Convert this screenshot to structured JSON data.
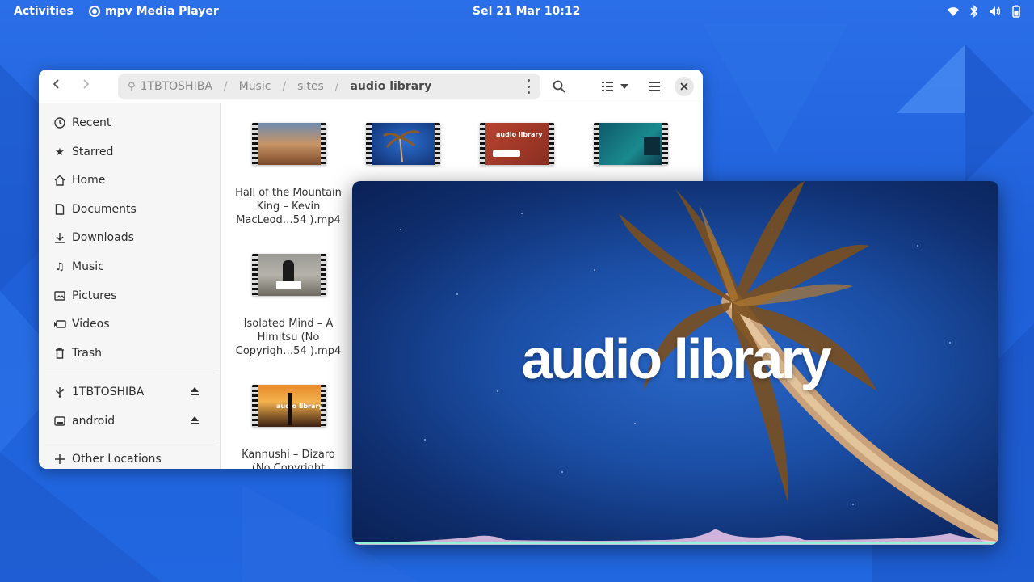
{
  "topbar": {
    "activities": "Activities",
    "app_name": "mpv Media Player",
    "clock": "Sel 21 Mar  10:12",
    "tray_icons": [
      "wifi-icon",
      "bluetooth-icon",
      "volume-icon",
      "battery-icon"
    ]
  },
  "files": {
    "path": {
      "device": "1TBTOSHIBA",
      "segments": [
        "Music",
        "sites"
      ],
      "current": "audio library"
    },
    "sidebar": {
      "places": [
        {
          "label": "Recent",
          "icon": "clock-icon"
        },
        {
          "label": "Starred",
          "icon": "star-icon"
        },
        {
          "label": "Home",
          "icon": "home-icon"
        },
        {
          "label": "Documents",
          "icon": "document-icon"
        },
        {
          "label": "Downloads",
          "icon": "download-icon"
        },
        {
          "label": "Music",
          "icon": "music-icon"
        },
        {
          "label": "Pictures",
          "icon": "picture-icon"
        },
        {
          "label": "Videos",
          "icon": "video-icon"
        },
        {
          "label": "Trash",
          "icon": "trash-icon"
        }
      ],
      "devices": [
        {
          "label": "1TBTOSHIBA",
          "icon": "usb-icon"
        },
        {
          "label": "android",
          "icon": "drive-icon"
        }
      ],
      "other": "Other Locations"
    },
    "items": [
      {
        "caption": [
          "Hall of the Mountain",
          "King – Kevin",
          "MacLeod…54 ).mp4"
        ]
      },
      {
        "caption": [
          "Isolated Mind – A",
          "Himitsu (No",
          "Copyrigh…54 ).mp4"
        ]
      },
      {
        "caption": [
          "Kannushi – Dizaro",
          "(No Copyright"
        ]
      }
    ],
    "thumb_text": {
      "t3": "audio library",
      "t4": "audio library",
      "t7": "audio library"
    }
  },
  "player": {
    "video_title": "audio library"
  },
  "colors": {
    "accent": "#3584e4",
    "desktop": "#1f5fd8"
  }
}
